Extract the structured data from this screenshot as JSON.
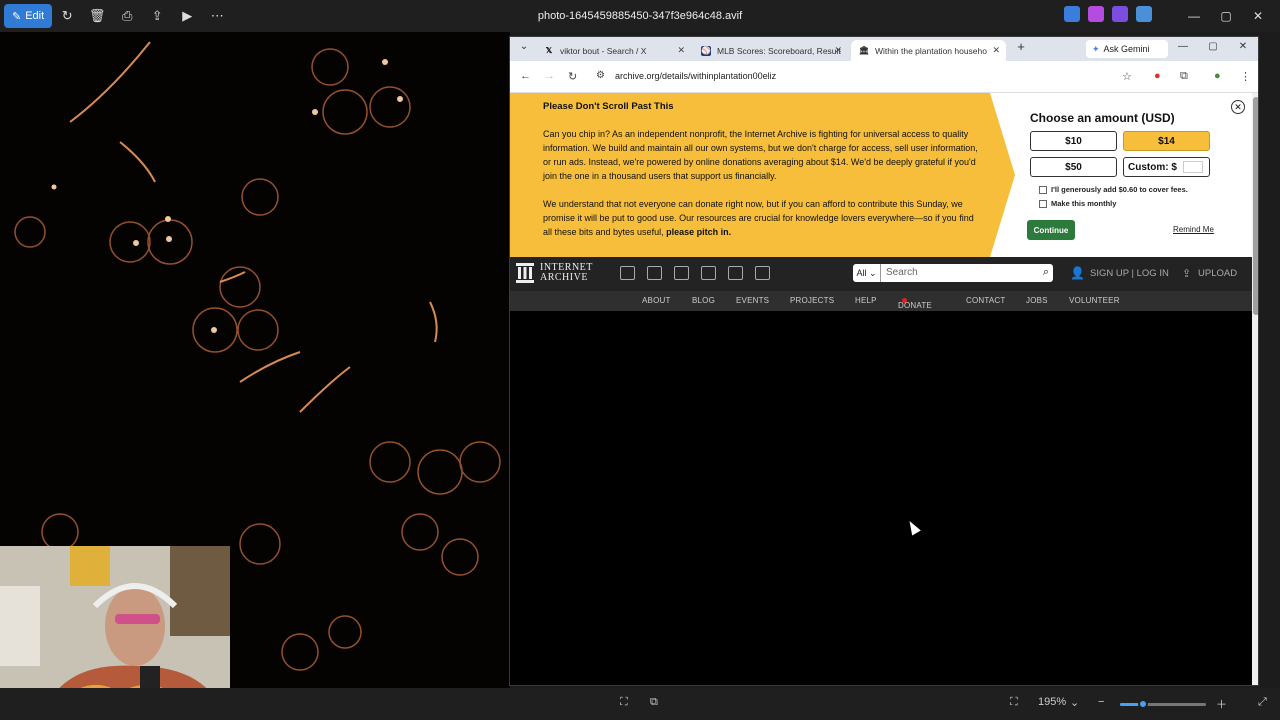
{
  "viewer": {
    "edit_label": "Edit",
    "title": "photo-1645459885450-347f3e964c48.avif",
    "zoom_level": "195%",
    "zoom_fraction": 0.27,
    "toolbar_icons": [
      "rotate-icon",
      "delete-icon",
      "print-icon",
      "share-icon",
      "slideshow-icon",
      "more-icon"
    ],
    "tray_colors": [
      "#3b7ddd",
      "#b44ddf",
      "#7a4fdf",
      "#4b8fd8"
    ]
  },
  "browser": {
    "tabs": [
      {
        "label": "viktor bout - Search / X",
        "icon": "x-icon"
      },
      {
        "label": "MLB Scores: Scoreboard, Result",
        "icon": "mlb-icon"
      },
      {
        "label": "Within the plantation househo",
        "icon": "archive-icon"
      }
    ],
    "gemini_label": "Ask Gemini",
    "url": "archive.org/details/withinplantation00eliz"
  },
  "donate": {
    "heading": "Please Don't Scroll Past This",
    "para1": "Can you chip in? As an independent nonprofit, the Internet Archive is fighting for universal access to quality information. We build and maintain all our own systems, but we don't charge for access, sell user information, or run ads. Instead, we're powered by online donations averaging about $14. We'd be deeply grateful if you'd join the one in a thousand users that support us financially.",
    "para2_text": "We understand that not everyone can donate right now, but if you can afford to contribute this Sunday, we promise it will be put to good use. Our resources are crucial for knowledge lovers everywhere—so if you find all these bits and bytes useful, ",
    "para2_bold": "please pitch in.",
    "choose_heading": "Choose an amount (USD)",
    "amounts": [
      "$10",
      "$14",
      "$50"
    ],
    "custom_label": "Custom: $",
    "fee_label": "I'll generously add $0.60 to cover fees.",
    "monthly_label": "Make this monthly",
    "continue_label": "Continue",
    "remind_label": "Remind Me",
    "accent_color": "#f6be3a"
  },
  "ia": {
    "logo_line1": "INTERNET",
    "logo_line2": "ARCHIVE",
    "search_scope": "All",
    "search_placeholder": "Search",
    "signup_label": "SIGN UP | LOG IN",
    "upload_label": "UPLOAD",
    "nav": [
      "ABOUT",
      "BLOG",
      "EVENTS",
      "PROJECTS",
      "HELP",
      "DONATE",
      "CONTACT",
      "JOBS",
      "VOLUNTEER"
    ]
  }
}
